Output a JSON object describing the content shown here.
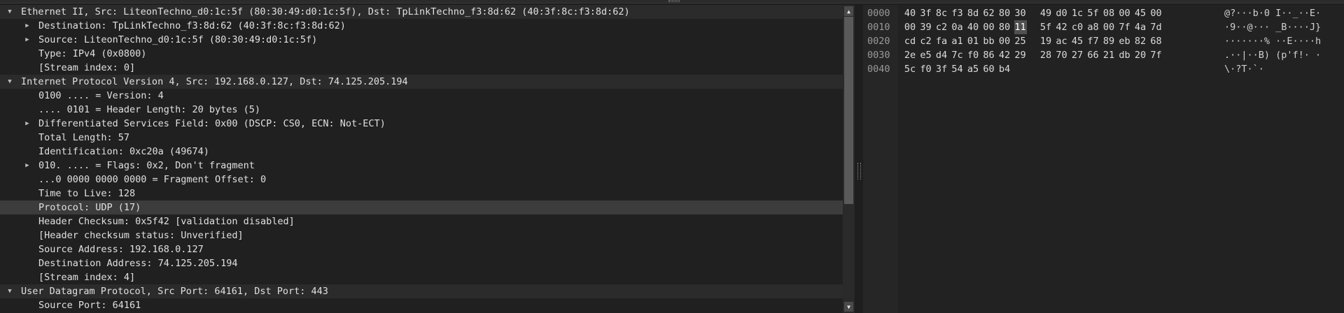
{
  "tree": {
    "rows": [
      {
        "text": "Ethernet II, Src: LiteonTechno_d0:1c:5f (80:30:49:d0:1c:5f), Dst: TpLinkTechno_f3:8d:62 (40:3f:8c:f3:8d:62)",
        "level": 0,
        "arrow": "expanded",
        "section": true
      },
      {
        "text": "Destination: TpLinkTechno_f3:8d:62 (40:3f:8c:f3:8d:62)",
        "level": 1,
        "arrow": "collapsed"
      },
      {
        "text": "Source: LiteonTechno_d0:1c:5f (80:30:49:d0:1c:5f)",
        "level": 1,
        "arrow": "collapsed"
      },
      {
        "text": "Type: IPv4 (0x0800)",
        "level": 1,
        "arrow": "none"
      },
      {
        "text": "[Stream index: 0]",
        "level": 1,
        "arrow": "none"
      },
      {
        "text": "Internet Protocol Version 4, Src: 192.168.0.127, Dst: 74.125.205.194",
        "level": 0,
        "arrow": "expanded",
        "section": true
      },
      {
        "text": "0100 .... = Version: 4",
        "level": 1,
        "arrow": "none"
      },
      {
        "text": ".... 0101 = Header Length: 20 bytes (5)",
        "level": 1,
        "arrow": "none"
      },
      {
        "text": "Differentiated Services Field: 0x00 (DSCP: CS0, ECN: Not-ECT)",
        "level": 1,
        "arrow": "collapsed"
      },
      {
        "text": "Total Length: 57",
        "level": 1,
        "arrow": "none"
      },
      {
        "text": "Identification: 0xc20a (49674)",
        "level": 1,
        "arrow": "none"
      },
      {
        "text": "010. .... = Flags: 0x2, Don't fragment",
        "level": 1,
        "arrow": "collapsed"
      },
      {
        "text": "...0 0000 0000 0000 = Fragment Offset: 0",
        "level": 1,
        "arrow": "none"
      },
      {
        "text": "Time to Live: 128",
        "level": 1,
        "arrow": "none"
      },
      {
        "text": "Protocol: UDP (17)",
        "level": 1,
        "arrow": "none",
        "selected": true
      },
      {
        "text": "Header Checksum: 0x5f42 [validation disabled]",
        "level": 1,
        "arrow": "none"
      },
      {
        "text": "[Header checksum status: Unverified]",
        "level": 1,
        "arrow": "none"
      },
      {
        "text": "Source Address: 192.168.0.127",
        "level": 1,
        "arrow": "none"
      },
      {
        "text": "Destination Address: 74.125.205.194",
        "level": 1,
        "arrow": "none"
      },
      {
        "text": "[Stream index: 4]",
        "level": 1,
        "arrow": "none"
      },
      {
        "text": "User Datagram Protocol, Src Port: 64161, Dst Port: 443",
        "level": 0,
        "arrow": "expanded",
        "section": true
      },
      {
        "text": "Source Port: 64161",
        "level": 1,
        "arrow": "none"
      }
    ]
  },
  "scrollbar": {
    "up_icon": "▲",
    "down_icon": "▼"
  },
  "bytes": {
    "rows": [
      {
        "offset": "0000",
        "hex": [
          "40",
          "3f",
          "8c",
          "f3",
          "8d",
          "62",
          "80",
          "30",
          "49",
          "d0",
          "1c",
          "5f",
          "08",
          "00",
          "45",
          "00"
        ],
        "ascii": "@?···b·0 I··_··E·"
      },
      {
        "offset": "0010",
        "hex": [
          "00",
          "39",
          "c2",
          "0a",
          "40",
          "00",
          "80",
          "11",
          "5f",
          "42",
          "c0",
          "a8",
          "00",
          "7f",
          "4a",
          "7d"
        ],
        "ascii": "·9··@··· _B····J}",
        "highlight": 7
      },
      {
        "offset": "0020",
        "hex": [
          "cd",
          "c2",
          "fa",
          "a1",
          "01",
          "bb",
          "00",
          "25",
          "19",
          "ac",
          "45",
          "f7",
          "89",
          "eb",
          "82",
          "68"
        ],
        "ascii": "·······% ··E····h"
      },
      {
        "offset": "0030",
        "hex": [
          "2e",
          "e5",
          "d4",
          "7c",
          "f0",
          "86",
          "42",
          "29",
          "28",
          "70",
          "27",
          "66",
          "21",
          "db",
          "20",
          "7f"
        ],
        "ascii": ".··|··B) (p'f!· ·"
      },
      {
        "offset": "0040",
        "hex": [
          "5c",
          "f0",
          "3f",
          "54",
          "a5",
          "60",
          "b4"
        ],
        "ascii": "\\·?T·`·"
      }
    ]
  }
}
